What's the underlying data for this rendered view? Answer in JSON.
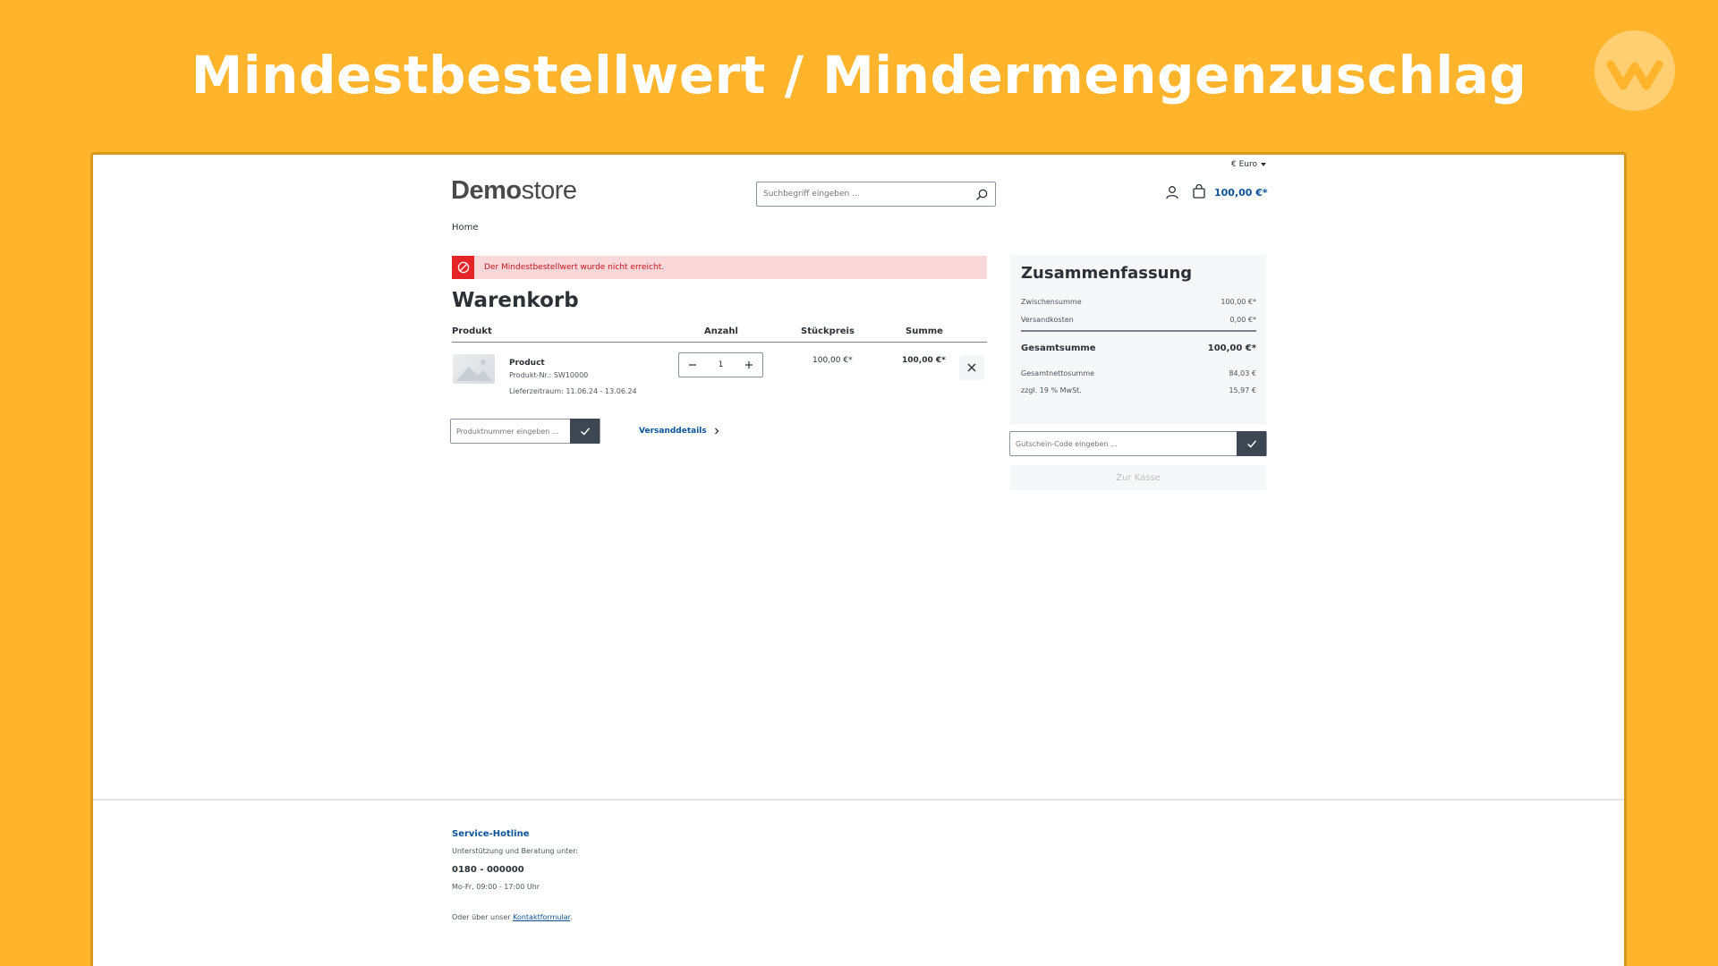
{
  "banner": {
    "title": "Mindestbestellwert / Mindermengenzuschlag"
  },
  "colors": {
    "background": "#FFB42C",
    "link": "#0b539b",
    "alert_bg": "#fad7d9",
    "alert_icon": "#e52427",
    "button_dark": "#3c4752"
  },
  "header": {
    "currency": "€ Euro",
    "logo_bold": "Demo",
    "logo_light": "store",
    "search_placeholder": "Suchbegriff eingeben ...",
    "cart_total": "100,00 €*"
  },
  "breadcrumb": "Home",
  "alert": {
    "icon": "blocked-icon",
    "message": "Der Mindestbestellwert wurde nicht erreicht."
  },
  "cart": {
    "heading": "Warenkorb",
    "columns": {
      "product": "Produkt",
      "quantity": "Anzahl",
      "unit_price": "Stückpreis",
      "total": "Summe"
    },
    "items": [
      {
        "name": "Product",
        "number": "Produkt-Nr.: SW10000",
        "delivery": "Lieferzeitraum: 11.06.24 - 13.06.24",
        "quantity": "1",
        "unit_price": "100,00 €*",
        "total": "100,00 €*"
      }
    ],
    "add_product_placeholder": "Produktnummer eingeben ...",
    "shipping_link": "Versanddetails"
  },
  "summary": {
    "title": "Zusammenfassung",
    "subtotal_label": "Zwischensumme",
    "subtotal": "100,00 €*",
    "shipping_label": "Versandkosten",
    "shipping": "0,00 €*",
    "total_label": "Gesamtsumme",
    "total": "100,00 €*",
    "net_label": "Gesamtnettosumme",
    "net": "84,03 €",
    "vat_label": "zzgl. 19 % MwSt.",
    "vat": "15,97 €",
    "voucher_placeholder": "Gutschein-Code eingeben ...",
    "checkout_label": "Zur Kasse"
  },
  "footer": {
    "title": "Service-Hotline",
    "subtitle": "Unterstützung und Beratung unter:",
    "phone": "0180 - 000000",
    "hours": "Mo-Fr, 09:00 - 17:00 Uhr",
    "contact_prefix": "Oder über unser ",
    "contact_link": "Kontaktformular",
    "contact_suffix": "."
  }
}
